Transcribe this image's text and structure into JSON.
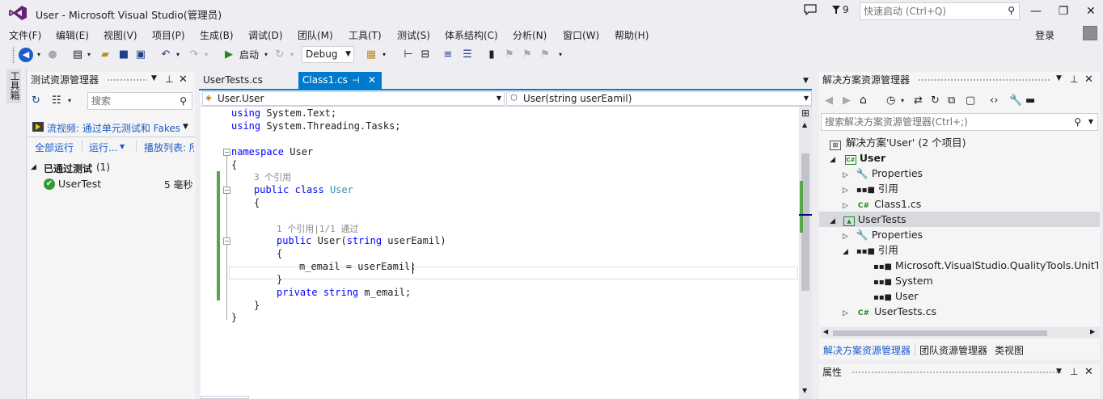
{
  "window": {
    "title": "User - Microsoft Visual Studio(管理员)",
    "notif_count": "9"
  },
  "quick_launch": {
    "placeholder": "快速启动 (Ctrl+Q)"
  },
  "menu": [
    "文件(F)",
    "编辑(E)",
    "视图(V)",
    "项目(P)",
    "生成(B)",
    "调试(D)",
    "团队(M)",
    "工具(T)",
    "测试(S)",
    "体系结构(C)",
    "分析(N)",
    "窗口(W)",
    "帮助(H)"
  ],
  "login": "登录",
  "toolbar": {
    "start_label": "启动",
    "config": "Debug"
  },
  "toolbox_label": "工具箱",
  "test_explorer": {
    "title": "测试资源管理器",
    "search_placeholder": "搜索",
    "stream_label": "流视频: 通过单元测试和 Fakes",
    "run_all": "全部运行",
    "run": "运行...",
    "playlist": "播放列表: 所",
    "group_label": "已通过测试",
    "group_count": "(1)",
    "test_name": "UserTest",
    "test_time": "5 毫秒"
  },
  "tabs": [
    {
      "label": "UserTests.cs"
    },
    {
      "label": "Class1.cs"
    }
  ],
  "nav": {
    "left": "User.User",
    "right": "User(string userEamil)"
  },
  "code": {
    "l1a": "using",
    "l1b": " System.Text;",
    "l2a": "using",
    "l2b": " System.Threading.Tasks;",
    "l3a": "namespace",
    "l3b": " User",
    "l4": "{",
    "l5": "3 个引用",
    "l6a": "public",
    "l6b": "class",
    "l6c": "User",
    "l7": "{",
    "l8": "1 个引用|1/1 通过",
    "l9a": "public",
    "l9b": " User(",
    "l9c": "string",
    "l9d": " userEamil)",
    "l10": "{",
    "l11": "m_email = userEamil;",
    "l12": "}",
    "l13a": "private",
    "l13b": "string",
    "l13c": " m_email;",
    "l14": "}",
    "l15": "}"
  },
  "solution_explorer": {
    "title": "解决方案资源管理器",
    "search_placeholder": "搜索解决方案资源管理器(Ctrl+;)",
    "solution": "解决方案'User' (2 个项目)",
    "items": [
      {
        "label": "User"
      },
      {
        "label": "Properties"
      },
      {
        "label": "引用"
      },
      {
        "label": "Class1.cs"
      },
      {
        "label": "UserTests"
      },
      {
        "label": "Properties"
      },
      {
        "label": "引用"
      },
      {
        "label": "Microsoft.VisualStudio.QualityTools.UnitTestF"
      },
      {
        "label": "System"
      },
      {
        "label": "User"
      },
      {
        "label": "UserTests.cs"
      }
    ],
    "bottom_tabs": [
      "解决方案资源管理器",
      "团队资源管理器",
      "类视图"
    ]
  },
  "properties": {
    "title": "属性"
  },
  "colors": {
    "accent": "#007ACC",
    "tab_active": "#007ACC",
    "change_bar": "#57A64A",
    "link": "#1E5CC8"
  }
}
